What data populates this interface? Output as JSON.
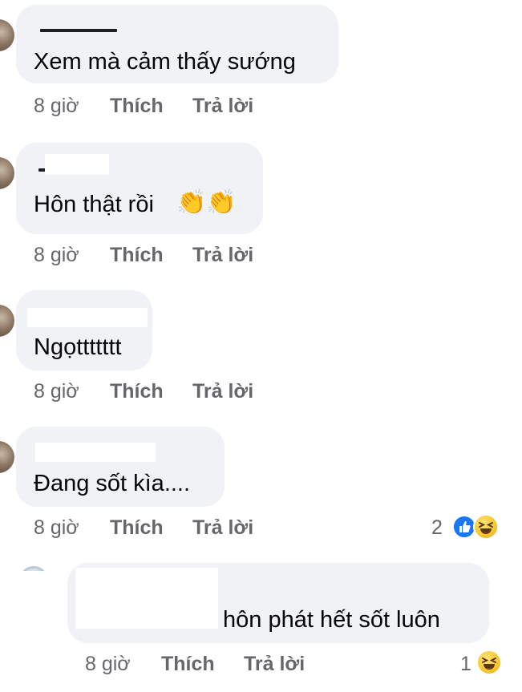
{
  "comments": [
    {
      "text": "Xem mà cảm thấy sướng",
      "time": "8 giờ",
      "like_label": "Thích",
      "reply_label": "Trả lời"
    },
    {
      "text": "Hôn thật rồi",
      "emoji": "👏👏",
      "time": "8 giờ",
      "like_label": "Thích",
      "reply_label": "Trả lời"
    },
    {
      "text": "Ngọttttttt",
      "time": "8 giờ",
      "like_label": "Thích",
      "reply_label": "Trả lời"
    },
    {
      "text": "Đang sốt kìa....",
      "time": "8 giờ",
      "like_label": "Thích",
      "reply_label": "Trả lời",
      "reaction_count": "2",
      "reactions": [
        "like-icon",
        "haha-icon"
      ]
    }
  ],
  "reply": {
    "text": "hôn phát hết sốt luôn",
    "time": "8 giờ",
    "like_label": "Thích",
    "reply_label": "Trả lời",
    "reaction_count": "1",
    "reactions": [
      "haha-icon"
    ]
  },
  "colors": {
    "bubble": "#f0f2f5",
    "meta": "#65676b",
    "like": "#1877f2",
    "haha": "#f7c531"
  }
}
